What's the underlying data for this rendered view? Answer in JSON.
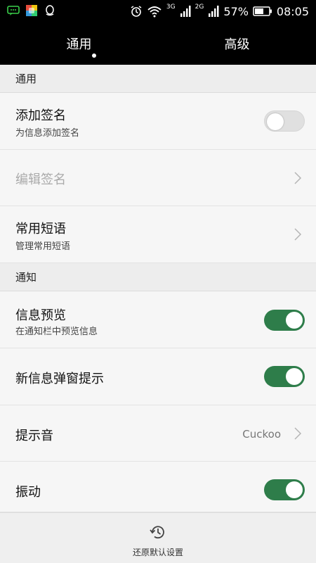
{
  "status_bar": {
    "left_icons": [
      "message-icon",
      "colorful-app-icon",
      "qq-icon"
    ],
    "network_a": "3G",
    "network_b": "2G",
    "battery_percent": "57%",
    "time": "08:05"
  },
  "tabs": [
    {
      "label": "通用",
      "selected": true
    },
    {
      "label": "高级",
      "selected": false
    }
  ],
  "sections": {
    "general": {
      "header": "通用",
      "rows": {
        "signature": {
          "title": "添加签名",
          "subtitle": "为信息添加签名",
          "toggle": false
        },
        "edit_signature": {
          "title": "编辑签名",
          "disabled": true
        },
        "phrases": {
          "title": "常用短语",
          "subtitle": "管理常用短语"
        }
      }
    },
    "notify": {
      "header": "通知",
      "rows": {
        "preview": {
          "title": "信息预览",
          "subtitle": "在通知栏中预览信息",
          "toggle": true
        },
        "popup": {
          "title": "新信息弹窗提示",
          "toggle": true
        },
        "ringtone": {
          "title": "提示音",
          "value": "Cuckoo"
        },
        "vibrate": {
          "title": "振动",
          "toggle": true
        }
      }
    }
  },
  "bottom": {
    "restore_label": "还原默认设置"
  },
  "colors": {
    "accent_green": "#2e7d4a",
    "toolbar_black": "#000000"
  }
}
